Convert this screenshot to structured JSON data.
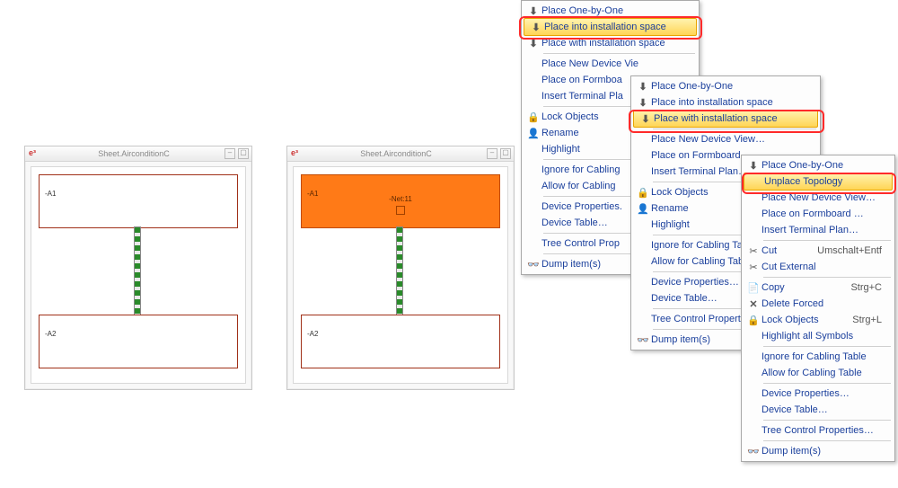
{
  "sheets": {
    "left": {
      "title": "Sheet.AirconditionC",
      "box1": "-A1",
      "box2": "-A2"
    },
    "right": {
      "title": "Sheet.AirconditionC",
      "box1": "-A1",
      "center1": "-Net:11",
      "box2": "-A2"
    }
  },
  "menu1": {
    "items": [
      {
        "icon": "⬇",
        "label": "Place One-by-One"
      },
      {
        "icon": "⬇",
        "label": "Place into installation space",
        "hilite": true
      },
      {
        "icon": "⬇",
        "label": "Place with installation space"
      }
    ],
    "items2": [
      {
        "label": "Place New Device Vie"
      },
      {
        "label": "Place on Formboa"
      },
      {
        "label": "Insert Terminal Pla"
      }
    ],
    "items3": [
      {
        "icon": "🔒",
        "label": "Lock Objects"
      },
      {
        "icon": "👤",
        "label": "Rename"
      },
      {
        "label": "Highlight"
      }
    ],
    "items4": [
      {
        "label": "Ignore for Cabling"
      },
      {
        "label": "Allow for Cabling"
      }
    ],
    "items5": [
      {
        "label": "Device Properties."
      },
      {
        "label": "Device Table…"
      }
    ],
    "items6": [
      {
        "label": "Tree Control Prop"
      }
    ],
    "items7": [
      {
        "icon": "👓",
        "label": "Dump item(s)"
      }
    ]
  },
  "menu2": {
    "items": [
      {
        "icon": "⬇",
        "label": "Place One-by-One"
      },
      {
        "icon": "⬇",
        "label": "Place into installation space"
      },
      {
        "icon": "⬇",
        "label": "Place with installation space",
        "hilite": true
      }
    ],
    "items2": [
      {
        "label": "Place New Device View…"
      },
      {
        "label": "Place on Formboard …"
      },
      {
        "label": "Insert Terminal Plan…"
      }
    ],
    "items3": [
      {
        "icon": "🔒",
        "label": "Lock Objects"
      },
      {
        "icon": "👤",
        "label": "Rename"
      },
      {
        "label": "Highlight"
      }
    ],
    "items4": [
      {
        "label": "Ignore for Cabling Tabl"
      },
      {
        "label": "Allow for Cabling Table"
      }
    ],
    "items5": [
      {
        "label": "Device Properties…"
      },
      {
        "label": "Device Table…"
      }
    ],
    "items6": [
      {
        "label": "Tree Control Properties"
      }
    ],
    "items7": [
      {
        "icon": "👓",
        "label": "Dump item(s)"
      }
    ]
  },
  "menu3": {
    "items": [
      {
        "icon": "⬇",
        "label": "Place One-by-One"
      },
      {
        "label": "Unplace Topology",
        "hilite": true
      },
      {
        "label": "Place New Device View…"
      },
      {
        "label": "Place on Formboard …"
      },
      {
        "label": "Insert Terminal Plan…"
      }
    ],
    "items2": [
      {
        "icon": "✂",
        "label": "Cut",
        "shortcut": "Umschalt+Entf"
      },
      {
        "icon": "✂",
        "label": "Cut External"
      }
    ],
    "items3": [
      {
        "icon": "📄",
        "label": "Copy",
        "shortcut": "Strg+C"
      },
      {
        "icon": "✕",
        "label": "Delete Forced"
      },
      {
        "icon": "🔒",
        "label": "Lock Objects",
        "shortcut": "Strg+L"
      },
      {
        "label": "Highlight all Symbols"
      }
    ],
    "items4": [
      {
        "label": "Ignore for Cabling Table"
      },
      {
        "label": "Allow for Cabling Table"
      }
    ],
    "items5": [
      {
        "label": "Device Properties…"
      },
      {
        "label": "Device Table…"
      }
    ],
    "items6": [
      {
        "label": "Tree Control Properties…"
      }
    ],
    "items7": [
      {
        "icon": "👓",
        "label": "Dump item(s)"
      }
    ]
  }
}
